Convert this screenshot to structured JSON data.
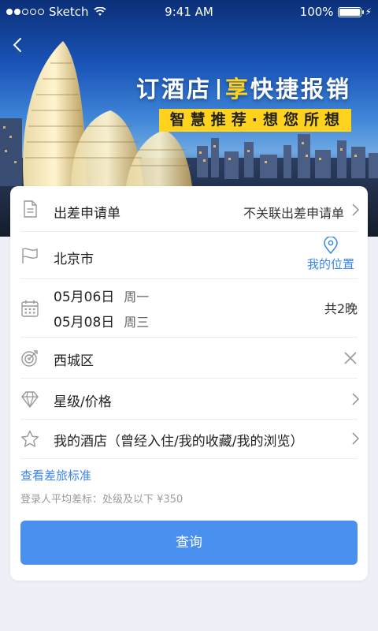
{
  "status_bar": {
    "carrier": "Sketch",
    "time": "9:41 AM",
    "battery": "100%",
    "battery_level": 1.0
  },
  "hero": {
    "slogan_part1": "订酒店",
    "slogan_highlight": "享",
    "slogan_part2": "快捷报销",
    "tagline": "智慧推荐·想您所想"
  },
  "form": {
    "trip_request": {
      "label": "出差申请单",
      "value": "不关联出差申请单"
    },
    "city": {
      "label": "北京市",
      "location_button": "我的位置"
    },
    "dates": {
      "checkin_date": "05月06日",
      "checkin_weekday": "周一",
      "checkout_date": "05月08日",
      "checkout_weekday": "周三",
      "nights": "共2晚"
    },
    "district": {
      "label": "西城区"
    },
    "star_price": {
      "label": "星级/价格"
    },
    "my_hotels": {
      "label": "我的酒店（曾经入住/我的收藏/我的浏览）"
    }
  },
  "travel_standard": {
    "link": "查看差旅标准",
    "note": "登录人平均差标：处级及以下 ¥350"
  },
  "actions": {
    "query": "查询"
  },
  "colors": {
    "accent": "#4a90ee",
    "link": "#3a85e8",
    "highlight_yellow": "#ffd21e",
    "background": "#eef0f7"
  }
}
